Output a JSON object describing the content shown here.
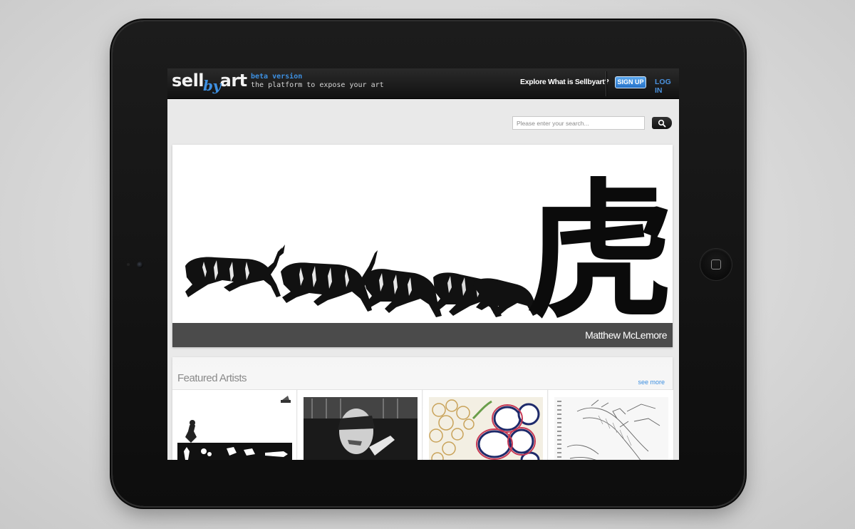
{
  "header": {
    "logo_sell": "sell",
    "logo_by": "by",
    "logo_art": "art",
    "beta_label": "beta version",
    "tagline": "the platform to expose your art",
    "nav_explore": "Explore",
    "nav_what": "What is Sellbyart?",
    "signup_label": "SIGN UP",
    "login_label": "LOG IN"
  },
  "search": {
    "placeholder": "Please enter your search..."
  },
  "hero": {
    "artist_name": "Matthew McLemore",
    "kanji": "虎"
  },
  "featured": {
    "title": "Featured Artists",
    "see_more": "see more"
  },
  "colors": {
    "accent": "#3d8fe0",
    "topbar": "#1a1a1a",
    "caption_bar": "#4b4b4b"
  },
  "icons": {
    "search_button": "search-icon",
    "home_button": "home-button-icon"
  }
}
